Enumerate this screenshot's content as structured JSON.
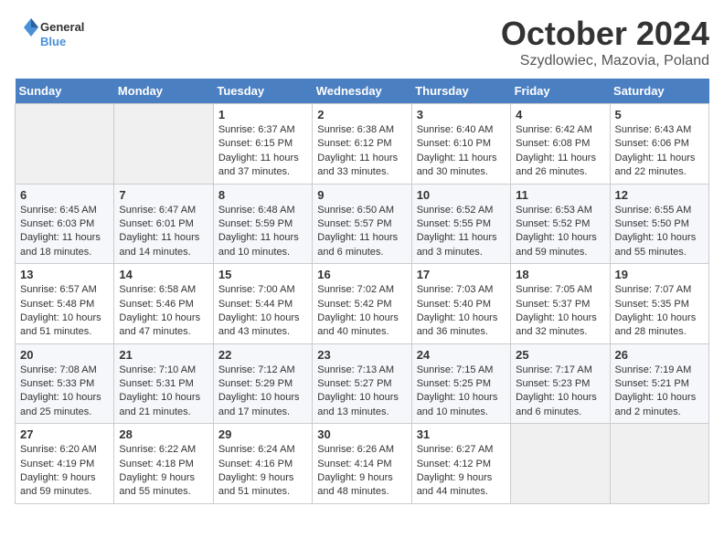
{
  "header": {
    "logo_general": "General",
    "logo_blue": "Blue",
    "month": "October 2024",
    "location": "Szydlowiec, Mazovia, Poland"
  },
  "weekdays": [
    "Sunday",
    "Monday",
    "Tuesday",
    "Wednesday",
    "Thursday",
    "Friday",
    "Saturday"
  ],
  "weeks": [
    [
      {
        "day": "",
        "empty": true
      },
      {
        "day": "",
        "empty": true
      },
      {
        "day": "1",
        "sunrise": "6:37 AM",
        "sunset": "6:15 PM",
        "daylight": "11 hours and 37 minutes."
      },
      {
        "day": "2",
        "sunrise": "6:38 AM",
        "sunset": "6:12 PM",
        "daylight": "11 hours and 33 minutes."
      },
      {
        "day": "3",
        "sunrise": "6:40 AM",
        "sunset": "6:10 PM",
        "daylight": "11 hours and 30 minutes."
      },
      {
        "day": "4",
        "sunrise": "6:42 AM",
        "sunset": "6:08 PM",
        "daylight": "11 hours and 26 minutes."
      },
      {
        "day": "5",
        "sunrise": "6:43 AM",
        "sunset": "6:06 PM",
        "daylight": "11 hours and 22 minutes."
      }
    ],
    [
      {
        "day": "6",
        "sunrise": "6:45 AM",
        "sunset": "6:03 PM",
        "daylight": "11 hours and 18 minutes."
      },
      {
        "day": "7",
        "sunrise": "6:47 AM",
        "sunset": "6:01 PM",
        "daylight": "11 hours and 14 minutes."
      },
      {
        "day": "8",
        "sunrise": "6:48 AM",
        "sunset": "5:59 PM",
        "daylight": "11 hours and 10 minutes."
      },
      {
        "day": "9",
        "sunrise": "6:50 AM",
        "sunset": "5:57 PM",
        "daylight": "11 hours and 6 minutes."
      },
      {
        "day": "10",
        "sunrise": "6:52 AM",
        "sunset": "5:55 PM",
        "daylight": "11 hours and 3 minutes."
      },
      {
        "day": "11",
        "sunrise": "6:53 AM",
        "sunset": "5:52 PM",
        "daylight": "10 hours and 59 minutes."
      },
      {
        "day": "12",
        "sunrise": "6:55 AM",
        "sunset": "5:50 PM",
        "daylight": "10 hours and 55 minutes."
      }
    ],
    [
      {
        "day": "13",
        "sunrise": "6:57 AM",
        "sunset": "5:48 PM",
        "daylight": "10 hours and 51 minutes."
      },
      {
        "day": "14",
        "sunrise": "6:58 AM",
        "sunset": "5:46 PM",
        "daylight": "10 hours and 47 minutes."
      },
      {
        "day": "15",
        "sunrise": "7:00 AM",
        "sunset": "5:44 PM",
        "daylight": "10 hours and 43 minutes."
      },
      {
        "day": "16",
        "sunrise": "7:02 AM",
        "sunset": "5:42 PM",
        "daylight": "10 hours and 40 minutes."
      },
      {
        "day": "17",
        "sunrise": "7:03 AM",
        "sunset": "5:40 PM",
        "daylight": "10 hours and 36 minutes."
      },
      {
        "day": "18",
        "sunrise": "7:05 AM",
        "sunset": "5:37 PM",
        "daylight": "10 hours and 32 minutes."
      },
      {
        "day": "19",
        "sunrise": "7:07 AM",
        "sunset": "5:35 PM",
        "daylight": "10 hours and 28 minutes."
      }
    ],
    [
      {
        "day": "20",
        "sunrise": "7:08 AM",
        "sunset": "5:33 PM",
        "daylight": "10 hours and 25 minutes."
      },
      {
        "day": "21",
        "sunrise": "7:10 AM",
        "sunset": "5:31 PM",
        "daylight": "10 hours and 21 minutes."
      },
      {
        "day": "22",
        "sunrise": "7:12 AM",
        "sunset": "5:29 PM",
        "daylight": "10 hours and 17 minutes."
      },
      {
        "day": "23",
        "sunrise": "7:13 AM",
        "sunset": "5:27 PM",
        "daylight": "10 hours and 13 minutes."
      },
      {
        "day": "24",
        "sunrise": "7:15 AM",
        "sunset": "5:25 PM",
        "daylight": "10 hours and 10 minutes."
      },
      {
        "day": "25",
        "sunrise": "7:17 AM",
        "sunset": "5:23 PM",
        "daylight": "10 hours and 6 minutes."
      },
      {
        "day": "26",
        "sunrise": "7:19 AM",
        "sunset": "5:21 PM",
        "daylight": "10 hours and 2 minutes."
      }
    ],
    [
      {
        "day": "27",
        "sunrise": "6:20 AM",
        "sunset": "4:19 PM",
        "daylight": "9 hours and 59 minutes."
      },
      {
        "day": "28",
        "sunrise": "6:22 AM",
        "sunset": "4:18 PM",
        "daylight": "9 hours and 55 minutes."
      },
      {
        "day": "29",
        "sunrise": "6:24 AM",
        "sunset": "4:16 PM",
        "daylight": "9 hours and 51 minutes."
      },
      {
        "day": "30",
        "sunrise": "6:26 AM",
        "sunset": "4:14 PM",
        "daylight": "9 hours and 48 minutes."
      },
      {
        "day": "31",
        "sunrise": "6:27 AM",
        "sunset": "4:12 PM",
        "daylight": "9 hours and 44 minutes."
      },
      {
        "day": "",
        "empty": true
      },
      {
        "day": "",
        "empty": true
      }
    ]
  ]
}
